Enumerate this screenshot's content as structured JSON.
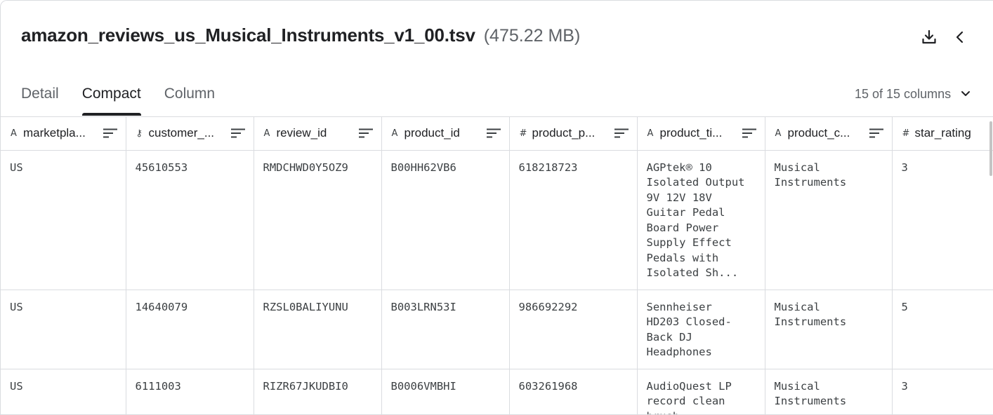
{
  "header": {
    "file_name": "amazon_reviews_us_Musical_Instruments_v1_00.tsv",
    "file_size": "(475.22 MB)",
    "download_icon": "download-icon",
    "collapse_icon": "chevron-left-icon"
  },
  "tabs": [
    {
      "label": "Detail",
      "active": false
    },
    {
      "label": "Compact",
      "active": true
    },
    {
      "label": "Column",
      "active": false
    }
  ],
  "column_selector": {
    "label": "15 of 15 columns",
    "icon": "chevron-down-icon"
  },
  "table": {
    "columns": [
      {
        "type_icon": "string-type-icon",
        "type_glyph": "A",
        "label": "marketpla..."
      },
      {
        "type_icon": "key-type-icon",
        "type_glyph": "⚷",
        "label": "customer_..."
      },
      {
        "type_icon": "string-type-icon",
        "type_glyph": "A",
        "label": "review_id"
      },
      {
        "type_icon": "string-type-icon",
        "type_glyph": "A",
        "label": "product_id"
      },
      {
        "type_icon": "number-type-icon",
        "type_glyph": "#",
        "label": "product_p..."
      },
      {
        "type_icon": "string-type-icon",
        "type_glyph": "A",
        "label": "product_ti..."
      },
      {
        "type_icon": "string-type-icon",
        "type_glyph": "A",
        "label": "product_c..."
      },
      {
        "type_icon": "number-type-icon",
        "type_glyph": "#",
        "label": "star_rating"
      }
    ],
    "rows": [
      [
        "US",
        "45610553",
        "RMDCHWD0Y5OZ9",
        "B00HH62VB6",
        "618218723",
        "AGPtek® 10\nIsolated Output\n9V 12V 18V\nGuitar Pedal\nBoard Power\nSupply Effect\nPedals with\nIsolated Sh...",
        "Musical\nInstruments",
        "3"
      ],
      [
        "US",
        "14640079",
        "RZSL0BALIYUNU",
        "B003LRN53I",
        "986692292",
        "Sennheiser\nHD203 Closed-\nBack DJ\nHeadphones",
        "Musical\nInstruments",
        "5"
      ],
      [
        "US",
        "6111003",
        "RIZR67JKUDBI0",
        "B0006VMBHI",
        "603261968",
        "AudioQuest LP\nrecord clean\nbrush",
        "Musical\nInstruments",
        "3"
      ]
    ]
  },
  "colors": {
    "text": "#202124",
    "muted": "#5f6368",
    "border": "#dadce0"
  }
}
